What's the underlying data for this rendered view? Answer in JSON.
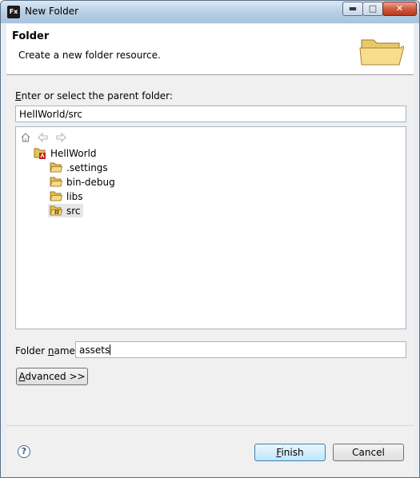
{
  "window": {
    "app_icon": "Fx",
    "title": "New Folder",
    "buttons": {
      "minimize": "minimize-icon",
      "maximize": "maximize-icon",
      "close": "close-icon"
    }
  },
  "header": {
    "title": "Folder",
    "description": "Create a new folder resource.",
    "icon": "folder-icon"
  },
  "parent": {
    "label": "Enter or select the parent folder:",
    "label_mnemonic": "E",
    "label_rest": "nter or select the parent folder:",
    "value": "HellWorld/src"
  },
  "nav": {
    "home_icon": "home-icon",
    "back_icon": "back-arrow-icon",
    "forward_icon": "forward-arrow-icon"
  },
  "tree": {
    "project": "HellWorld",
    "children": [
      ".settings",
      "bin-debug",
      "libs",
      "src"
    ],
    "selected": "src"
  },
  "folder_name": {
    "label": "Folder name:",
    "label_pre": "Folder ",
    "label_mnemonic": "n",
    "label_rest": "ame:",
    "value": "assets"
  },
  "advanced": {
    "label": "Advanced >>",
    "label_mnemonic": "A",
    "label_rest": "dvanced >>"
  },
  "footer": {
    "help": "?",
    "finish": "Finish",
    "finish_mnemonic": "F",
    "finish_rest": "inish",
    "cancel": "Cancel"
  }
}
